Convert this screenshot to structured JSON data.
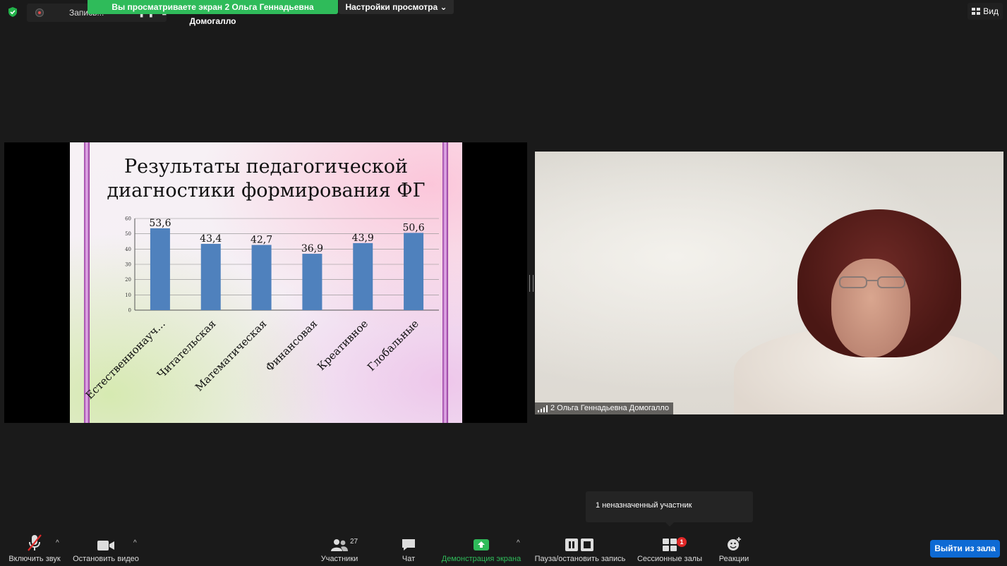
{
  "top_bar": {
    "recording_label": "Запись...",
    "recording_controls": "❚❚ ■",
    "sharing_banner": "Вы просматриваете экран 2 Ольга Геннадьевна Домогалло",
    "view_settings": "Настройки просмотра",
    "view_settings_caret": "⌄",
    "view_button": "Вид"
  },
  "slide": {
    "title_line1": "Результаты педагогической",
    "title_line2": "диагностики формирования ФГ"
  },
  "chart_data": {
    "type": "bar",
    "title": "Результаты педагогической диагностики формирования ФГ",
    "categories": [
      "Естественнонауч...",
      "Читательская",
      "Математическая",
      "Финансовая",
      "Креативное",
      "Глобальные"
    ],
    "values": [
      53.6,
      43.4,
      42.7,
      36.9,
      43.9,
      50.6
    ],
    "data_labels": [
      "53,6",
      "43,4",
      "42,7",
      "36,9",
      "43,9",
      "50,6"
    ],
    "yticks": [
      0,
      10,
      20,
      30,
      40,
      50,
      60
    ],
    "ylim": [
      0,
      60
    ],
    "bar_color": "#4f81bd",
    "grid": true
  },
  "video": {
    "participant_name": "2 Ольга Геннадьевна Домогалло"
  },
  "tooltip": {
    "text": "1 неназначенный участник"
  },
  "toolbar": {
    "mic_label": "Включить звук",
    "video_label": "Остановить видео",
    "participants_label": "Участники",
    "participants_count": "27",
    "chat_label": "Чат",
    "share_label": "Демонстрация экрана",
    "record_label": "Пауза/остановить запись",
    "breakout_label": "Сессионные залы",
    "breakout_badge": "1",
    "reactions_label": "Реакции",
    "leave_label": "Выйти из зала",
    "caret": "^"
  },
  "colors": {
    "banner": "#2fbb5a",
    "share_active": "#2fbb5a",
    "leave": "#0e6ad4",
    "badge": "#e02828",
    "mic_muted": "#e02828"
  }
}
